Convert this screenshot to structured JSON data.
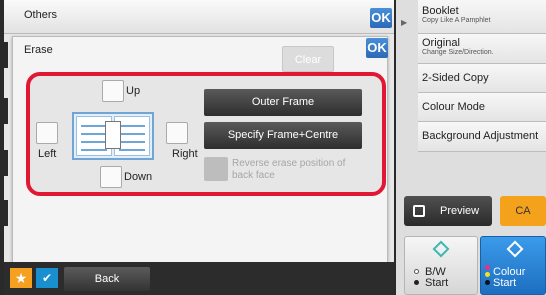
{
  "others_panel": {
    "title": "Others",
    "ok_label": "OK"
  },
  "erase_dialog": {
    "title": "Erase",
    "ok_label": "OK",
    "clear_label": "Clear",
    "edges": {
      "up": "Up",
      "left": "Left",
      "right": "Right",
      "down": "Down"
    },
    "outer_frame_label": "Outer Frame",
    "frame_centre_label": "Specify Frame+Centre",
    "reverse_label": "Reverse erase position of back face"
  },
  "bottom_bar": {
    "back_label": "Back",
    "star_icon": "★",
    "check_icon": "✔"
  },
  "right_panel": {
    "items": [
      {
        "label": "Booklet",
        "sublabel": "Copy Like A Pamphlet"
      },
      {
        "label": "Original",
        "sublabel": "Change Size/Direction."
      },
      {
        "label": "2-Sided Copy"
      },
      {
        "label": "Colour Mode"
      },
      {
        "label": "Background Adjustment"
      }
    ],
    "preview_label": "Preview",
    "ca_label": "CA",
    "bw_start_label_1": "B/W",
    "bw_start_label_2": "Start",
    "colour_start_label_1": "Colour",
    "colour_start_label_2": "Start"
  },
  "colors": {
    "highlight_frame": "#e01833",
    "ok_blue": "#2a6ab8",
    "colour_start": "#1d6ec0",
    "ca": "#f4a11c"
  }
}
